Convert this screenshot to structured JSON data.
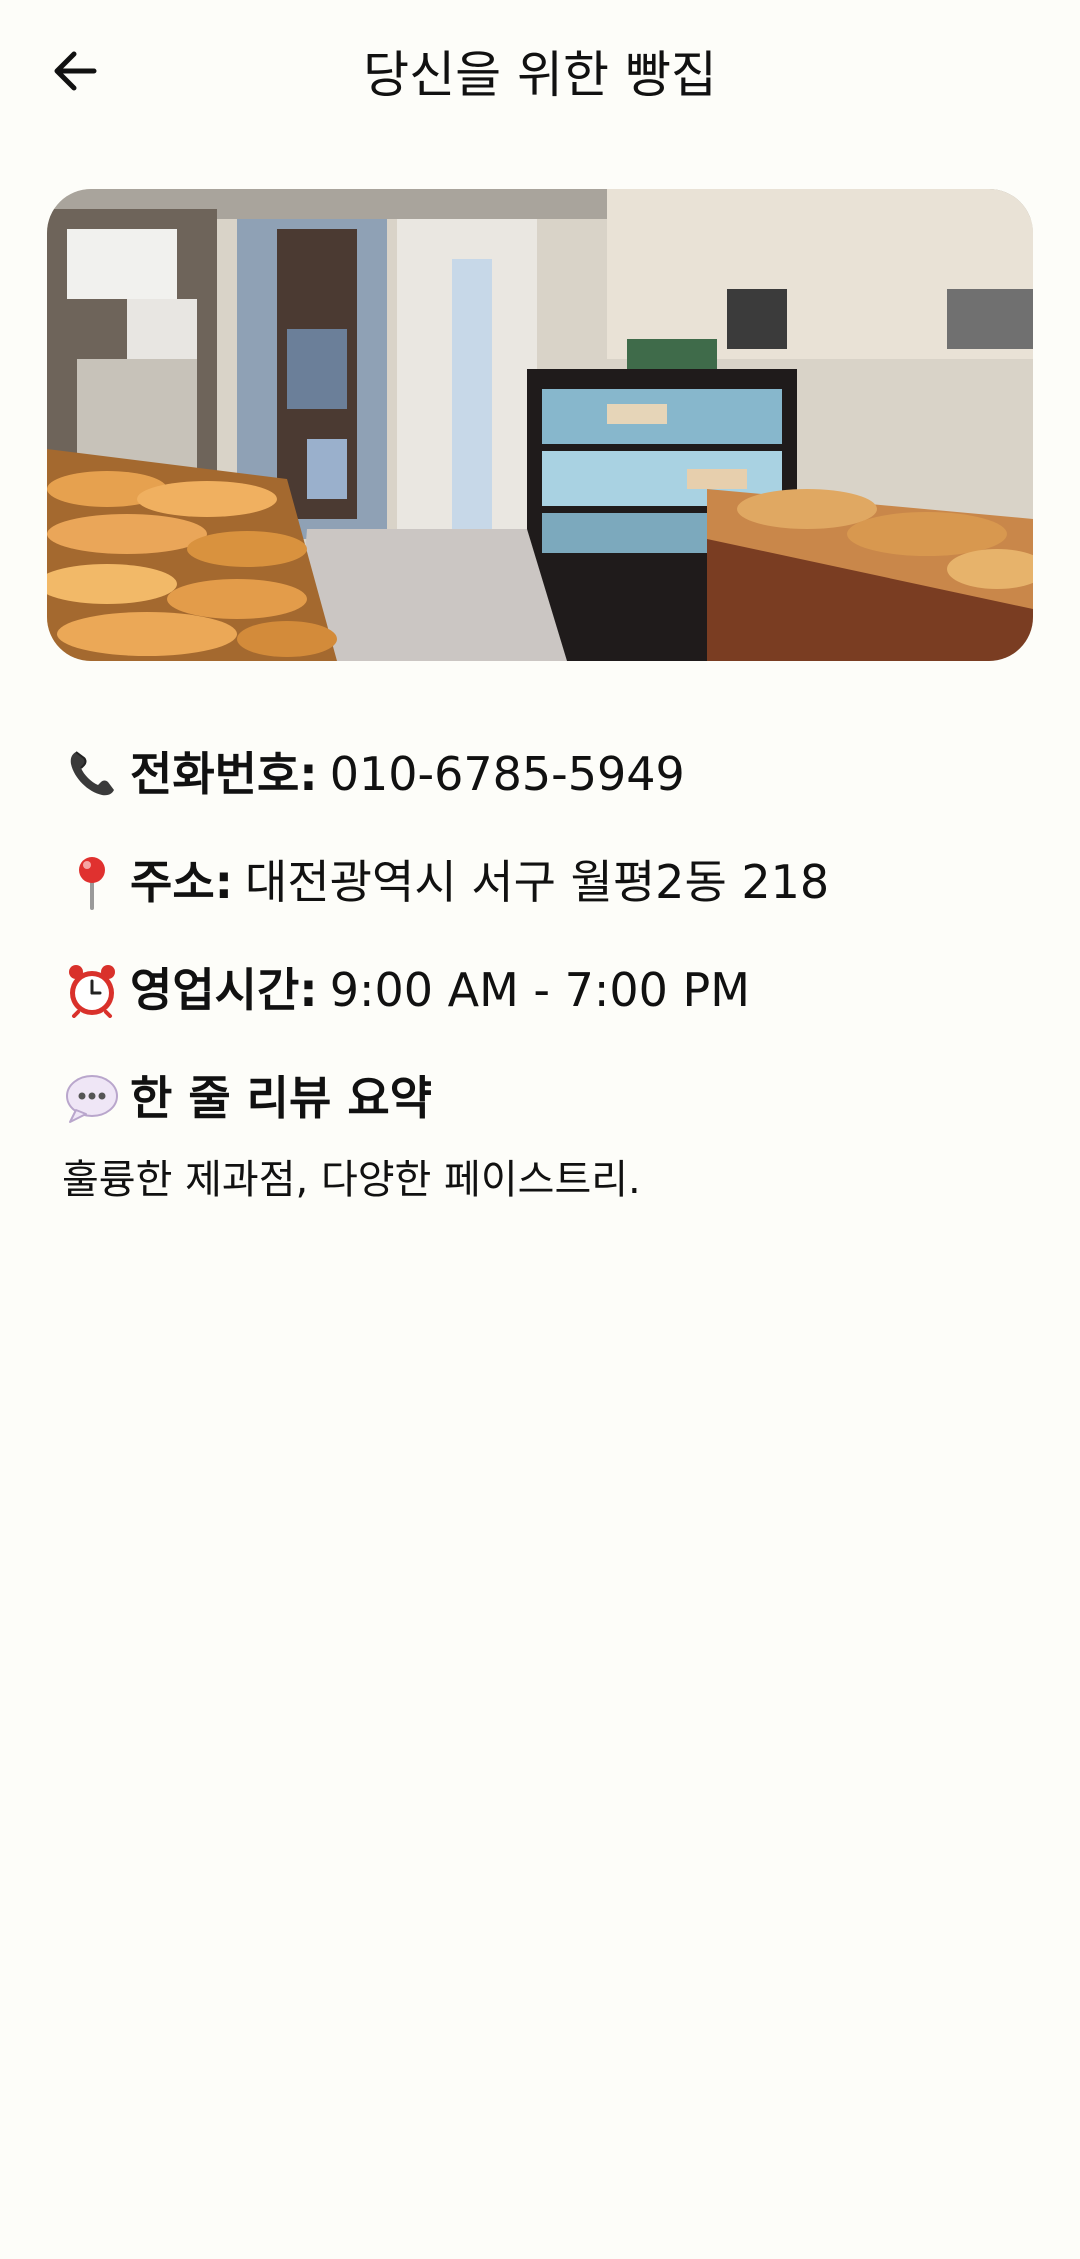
{
  "header": {
    "title": "당신을 위한 빵집",
    "back_icon": "arrow-left-icon"
  },
  "hero_image": {
    "description_icon": "bakery-photo"
  },
  "details": {
    "phone": {
      "icon": "telephone-icon",
      "label": "전화번호:",
      "value": "010-6785-5949"
    },
    "address": {
      "icon": "map-pin-icon",
      "label": "주소:",
      "value": "대전광역시 서구 월평2동 218"
    },
    "hours": {
      "icon": "alarm-clock-icon",
      "label": "영업시간:",
      "value": "9:00 AM - 7:00 PM"
    },
    "review": {
      "icon": "speech-bubble-icon",
      "heading": "한 줄 리뷰 요약",
      "text": "훌륭한 제과점, 다양한 페이스트리."
    }
  },
  "colors": {
    "background": "#fdfdf9",
    "text": "#111111",
    "pin_red": "#e0312f",
    "clock_red": "#d9312b"
  }
}
